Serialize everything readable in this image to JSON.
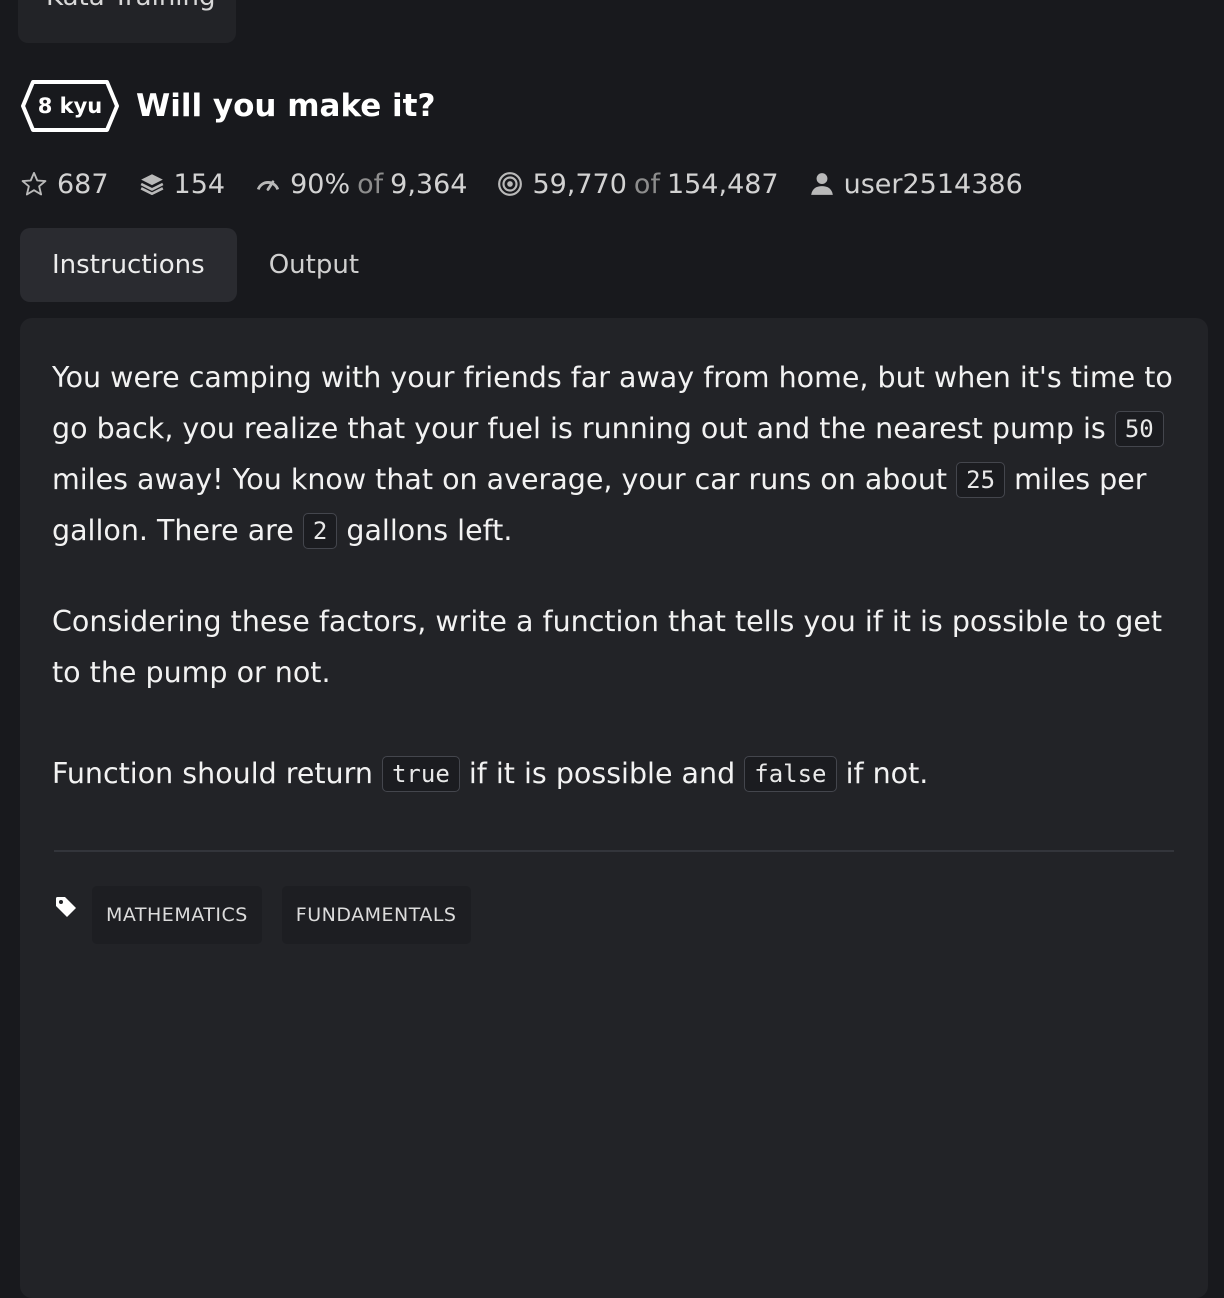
{
  "top_tab": {
    "label": "Kata Training"
  },
  "kata": {
    "rank": "8 kyu",
    "title": "Will you make it?"
  },
  "stats": {
    "stars": "687",
    "collections": "154",
    "satisfaction_percent": "90%",
    "satisfaction_of": "of",
    "satisfaction_votes": "9,364",
    "completed": "59,770",
    "completed_of": "of",
    "attempts": "154,487",
    "author": "user2514386"
  },
  "tabs": [
    {
      "label": "Instructions",
      "active": true
    },
    {
      "label": "Output",
      "active": false
    }
  ],
  "description": {
    "p1_a": "You were camping with your friends far away from home, but when it's time to go back, you realize that your fuel is running out and the nearest pump is",
    "p1_code_distance": "50",
    "p1_b": "miles away! You know that on average, your car runs on about",
    "p1_code_mpg": "25",
    "p1_c": "miles per gallon. There are",
    "p1_code_gallons": "2",
    "p1_d": "gallons left.",
    "p2": "Considering these factors, write a function that tells you if it is possible to get to the pump or not.",
    "p3_a": "Function should return",
    "p3_code_true": "true",
    "p3_b": "if it is possible and",
    "p3_code_false": "false",
    "p3_c": "if not."
  },
  "tags": [
    "MATHEMATICS",
    "FUNDAMENTALS"
  ],
  "colors": {
    "background": "#18191d",
    "panel": "#222327",
    "tab_active": "#2a2b30",
    "text": "#f2f2f2",
    "muted": "#8d8d8d"
  },
  "icons": {
    "stars": "star-icon",
    "collections": "stack-icon",
    "satisfaction": "gauge-icon",
    "completed": "target-icon",
    "author": "user-icon",
    "tags": "tag-icon"
  }
}
